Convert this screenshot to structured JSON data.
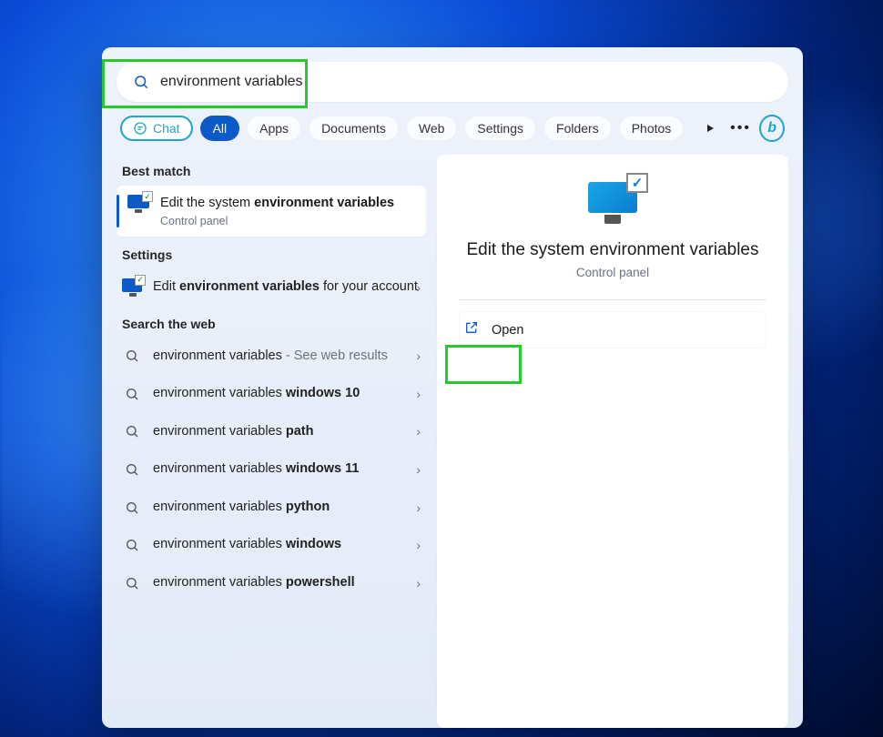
{
  "search": {
    "value": "environment variables"
  },
  "filters": {
    "chat": "Chat",
    "items": [
      "All",
      "Apps",
      "Documents",
      "Web",
      "Settings",
      "Folders",
      "Photos"
    ],
    "active_index": 0
  },
  "sections": {
    "best_match": "Best match",
    "settings": "Settings",
    "search_web": "Search the web"
  },
  "best_match_item": {
    "title_prefix": "Edit the system ",
    "title_bold": "environment variables",
    "subtitle": "Control panel"
  },
  "settings_item": {
    "prefix": "Edit ",
    "bold": "environment variables",
    "suffix": " for your account"
  },
  "web_items": [
    {
      "prefix": "environment variables",
      "bold": "",
      "suffix": " - See web results"
    },
    {
      "prefix": "environment variables ",
      "bold": "windows 10",
      "suffix": ""
    },
    {
      "prefix": "environment variables ",
      "bold": "path",
      "suffix": ""
    },
    {
      "prefix": "environment variables ",
      "bold": "windows 11",
      "suffix": ""
    },
    {
      "prefix": "environment variables ",
      "bold": "python",
      "suffix": ""
    },
    {
      "prefix": "environment variables ",
      "bold": "windows",
      "suffix": ""
    },
    {
      "prefix": "environment variables ",
      "bold": "powershell",
      "suffix": ""
    }
  ],
  "detail": {
    "title": "Edit the system environment variables",
    "subtitle": "Control panel",
    "open_label": "Open"
  }
}
